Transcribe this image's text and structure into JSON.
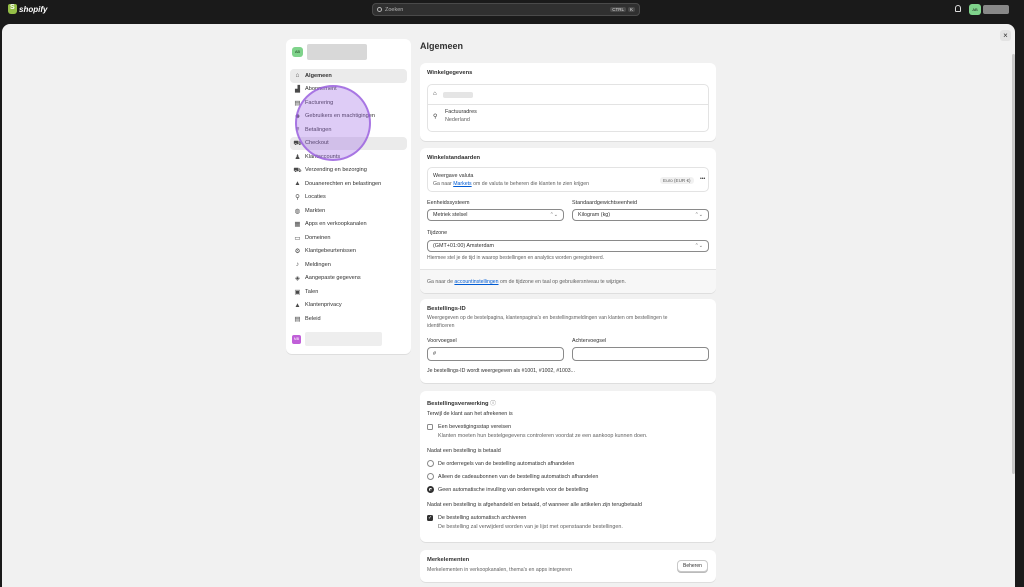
{
  "topbar": {
    "logo_text": "shopify",
    "search_placeholder": "Zoeken",
    "shortcut_keys": [
      "CTRL",
      "K"
    ],
    "user_avatar_initials": "AB"
  },
  "modal": {
    "close_glyph": "×"
  },
  "sidebar": {
    "store_avatar_initials": "AB",
    "items": [
      {
        "label": "Algemeen",
        "icon": "store-icon",
        "glyph": "⌂",
        "active": true
      },
      {
        "label": "Abonnement",
        "icon": "chart-icon",
        "glyph": "▟"
      },
      {
        "label": "Facturering",
        "icon": "bill-icon",
        "glyph": "▤"
      },
      {
        "label": "Gebruikers en machtigingen",
        "icon": "users-icon",
        "glyph": "☻"
      },
      {
        "label": "Betalingen",
        "icon": "payments-icon",
        "glyph": "≡"
      },
      {
        "label": "Checkout",
        "icon": "cart-icon",
        "glyph": "⛟",
        "hover": true
      },
      {
        "label": "Klantaccounts",
        "icon": "person-icon",
        "glyph": "♟"
      },
      {
        "label": "Verzending en bezorging",
        "icon": "truck-icon",
        "glyph": "⛟"
      },
      {
        "label": "Douanerechten en belastingen",
        "icon": "tax-icon",
        "glyph": "▲"
      },
      {
        "label": "Locaties",
        "icon": "location-icon",
        "glyph": "⚲"
      },
      {
        "label": "Markten",
        "icon": "globe-icon",
        "glyph": "◍"
      },
      {
        "label": "Apps en verkoopkanalen",
        "icon": "apps-icon",
        "glyph": "▦"
      },
      {
        "label": "Domeinen",
        "icon": "domain-icon",
        "glyph": "▭"
      },
      {
        "label": "Klantgebeurtenissen",
        "icon": "events-icon",
        "glyph": "⚙"
      },
      {
        "label": "Meldingen",
        "icon": "bell-icon",
        "glyph": "♪"
      },
      {
        "label": "Aangepaste gegevens",
        "icon": "data-icon",
        "glyph": "◈"
      },
      {
        "label": "Talen",
        "icon": "language-icon",
        "glyph": "▣"
      },
      {
        "label": "Klantenprivacy",
        "icon": "lock-icon",
        "glyph": "▲"
      },
      {
        "label": "Beleid",
        "icon": "policy-icon",
        "glyph": "▤"
      }
    ],
    "bottom_avatar_initials": "MB"
  },
  "main": {
    "title": "Algemeen",
    "store_details": {
      "title": "Winkelgegevens",
      "billing_label": "Factuuradres",
      "billing_country": "Nederland"
    },
    "defaults": {
      "title": "Winkelstandaarden",
      "currency_label": "Weergave valuta",
      "currency_help_prefix": "Ga naar ",
      "currency_help_link": "Markets",
      "currency_help_suffix": " om de valuta te beheren die klanten te zien krijgen",
      "currency_badge": "Euro (EUR €)",
      "more_glyph": "•••",
      "unit_label": "Eenheidssysteem",
      "unit_value": "Metriek stelsel",
      "weight_label": "Standaardgewichtseenheid",
      "weight_value": "Kilogram (kg)",
      "timezone_label": "Tijdzone",
      "timezone_value": "(GMT+01:00) Amsterdam",
      "timezone_help": "Hiermee stel je de tijd in waarop bestellingen en analytics worden geregistreerd.",
      "footer_prefix": "Ga naar de ",
      "footer_link": "accountinstellingen",
      "footer_suffix": " om de tijdzone en taal op gebruikersniveau te wijzigen.",
      "chevron": "⌃⌄"
    },
    "order_id": {
      "title": "Bestellings-ID",
      "description_line1": "Weergegeven op de bestelpagina, klantenpagina's en bestellingsmeldingen van klanten om bestellingen te",
      "description_line2": "identificeren",
      "prefix_label": "Voorvoegsel",
      "prefix_value": "#",
      "suffix_label": "Achtervoegsel",
      "suffix_value": "",
      "example": "Je bestellings-ID wordt weergegeven als #1001, #1002, #1003..."
    },
    "processing": {
      "title": "Bestellingsverwerking",
      "info_glyph": "ⓘ",
      "checkout_heading": "Terwijl de klant aan het afrekenen is",
      "confirm_label": "Een bevestigingsstap vereisen",
      "confirm_help": "Klanten moeten hun bestelgegevens controleren voordat ze een aankoop kunnen doen.",
      "paid_heading": "Nadat een bestelling is betaald",
      "radio_1": "De orderregels van de bestelling automatisch afhandelen",
      "radio_2": "Alleen de cadeaubonnen van de bestelling automatisch afhandelen",
      "radio_3": "Geen automatische invulling van orderregels voor de bestelling",
      "radio_selected": 3,
      "fulfilled_heading": "Nadat een bestelling is afgehandeld en betaald, of wanneer alle artikelen zijn terugbetaald",
      "archive_label": "De bestelling automatisch archiveren",
      "archive_help": "De bestelling zal verwijderd worden van je lijst met openstaande bestellingen.",
      "archive_checked": true,
      "check_glyph": "✓"
    },
    "brand": {
      "title": "Merkelementen",
      "description": "Merkelementen in verkoopkanalen, thema's en apps integreren",
      "button": "Beheren"
    }
  }
}
